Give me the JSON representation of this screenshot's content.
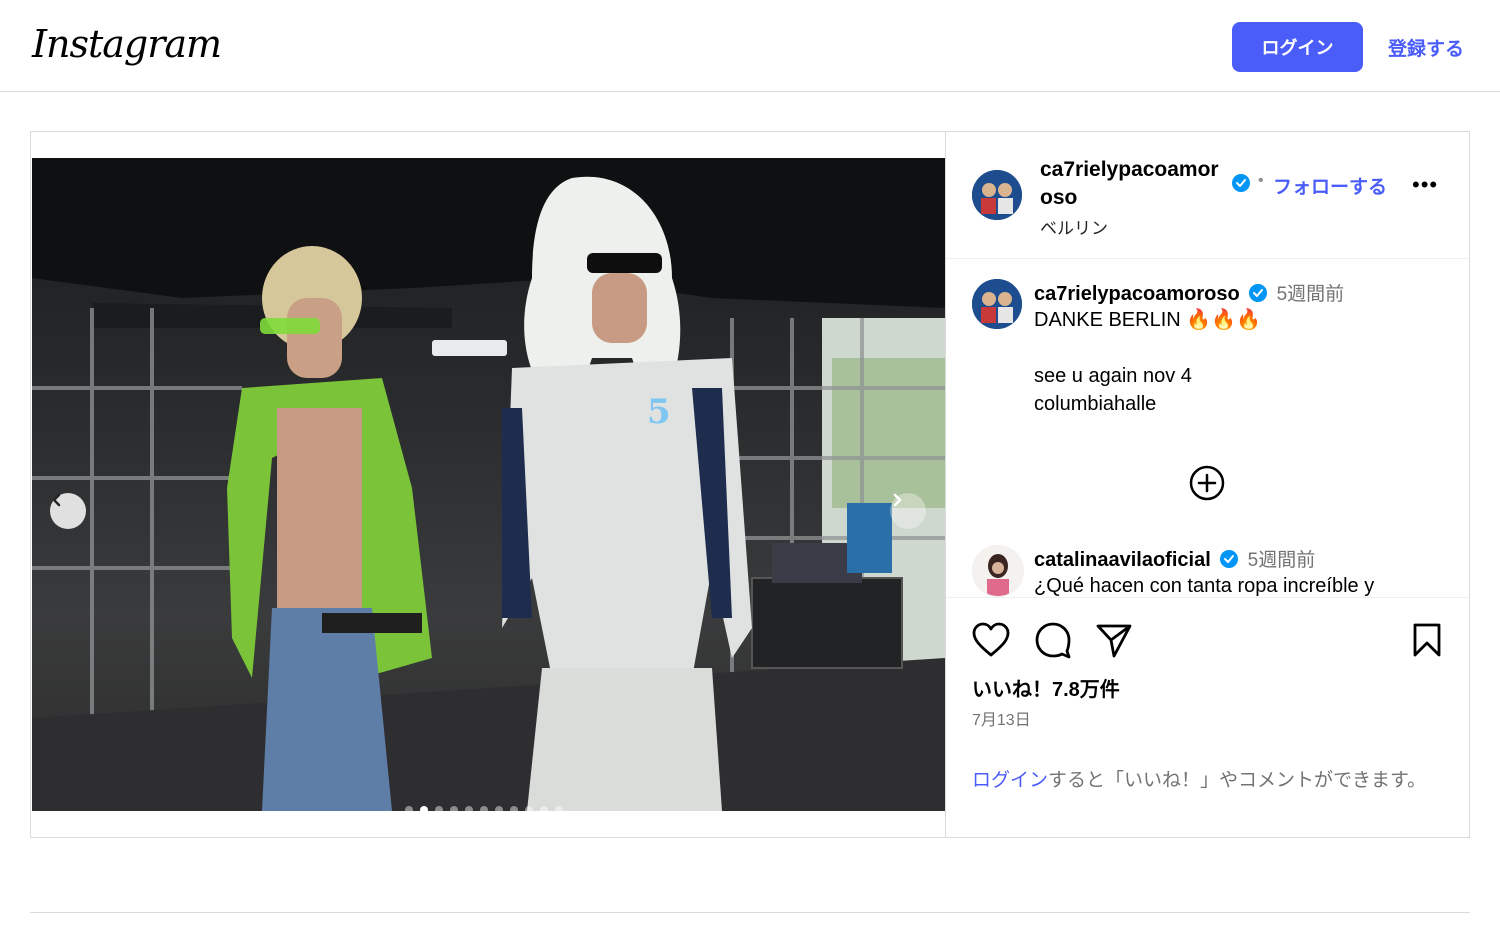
{
  "header": {
    "logo_text": "Instagram",
    "login_label": "ログイン",
    "signup_label": "登録する"
  },
  "media": {
    "slide_count": 11,
    "active_slide": 1
  },
  "post": {
    "author": {
      "handle": "ca7rielypacoamoroso",
      "location": "ベルリン",
      "verified": true
    },
    "follow_separator": "•",
    "follow_label": "フォローする",
    "more_label": "•••",
    "caption": {
      "handle": "ca7rielypacoamoroso",
      "time": "5週間前",
      "line1": "DANKE BERLIN 🔥🔥🔥",
      "line2": "see u again nov 4",
      "line3": "columbiahalle"
    },
    "comment": {
      "handle": "catalinaavilaoficial",
      "time": "5週間前",
      "text": "¿Qué hacen con tanta ropa increíble y"
    },
    "likes_label": "いいね！7.8万件",
    "date": "7月13日",
    "login_prompt_link": "ログイン",
    "login_prompt_rest": "すると「いいね！」やコメントができます。"
  },
  "colors": {
    "accent": "#4a5df9",
    "verified": "#0095f6",
    "border": "#dbdbdb"
  },
  "icons": {
    "like": "heart-icon",
    "comment": "comment-icon",
    "share": "paper-plane-icon",
    "save": "bookmark-icon",
    "add_comment": "plus-circle-icon",
    "prev": "chevron-left-icon",
    "next": "chevron-right-icon"
  }
}
